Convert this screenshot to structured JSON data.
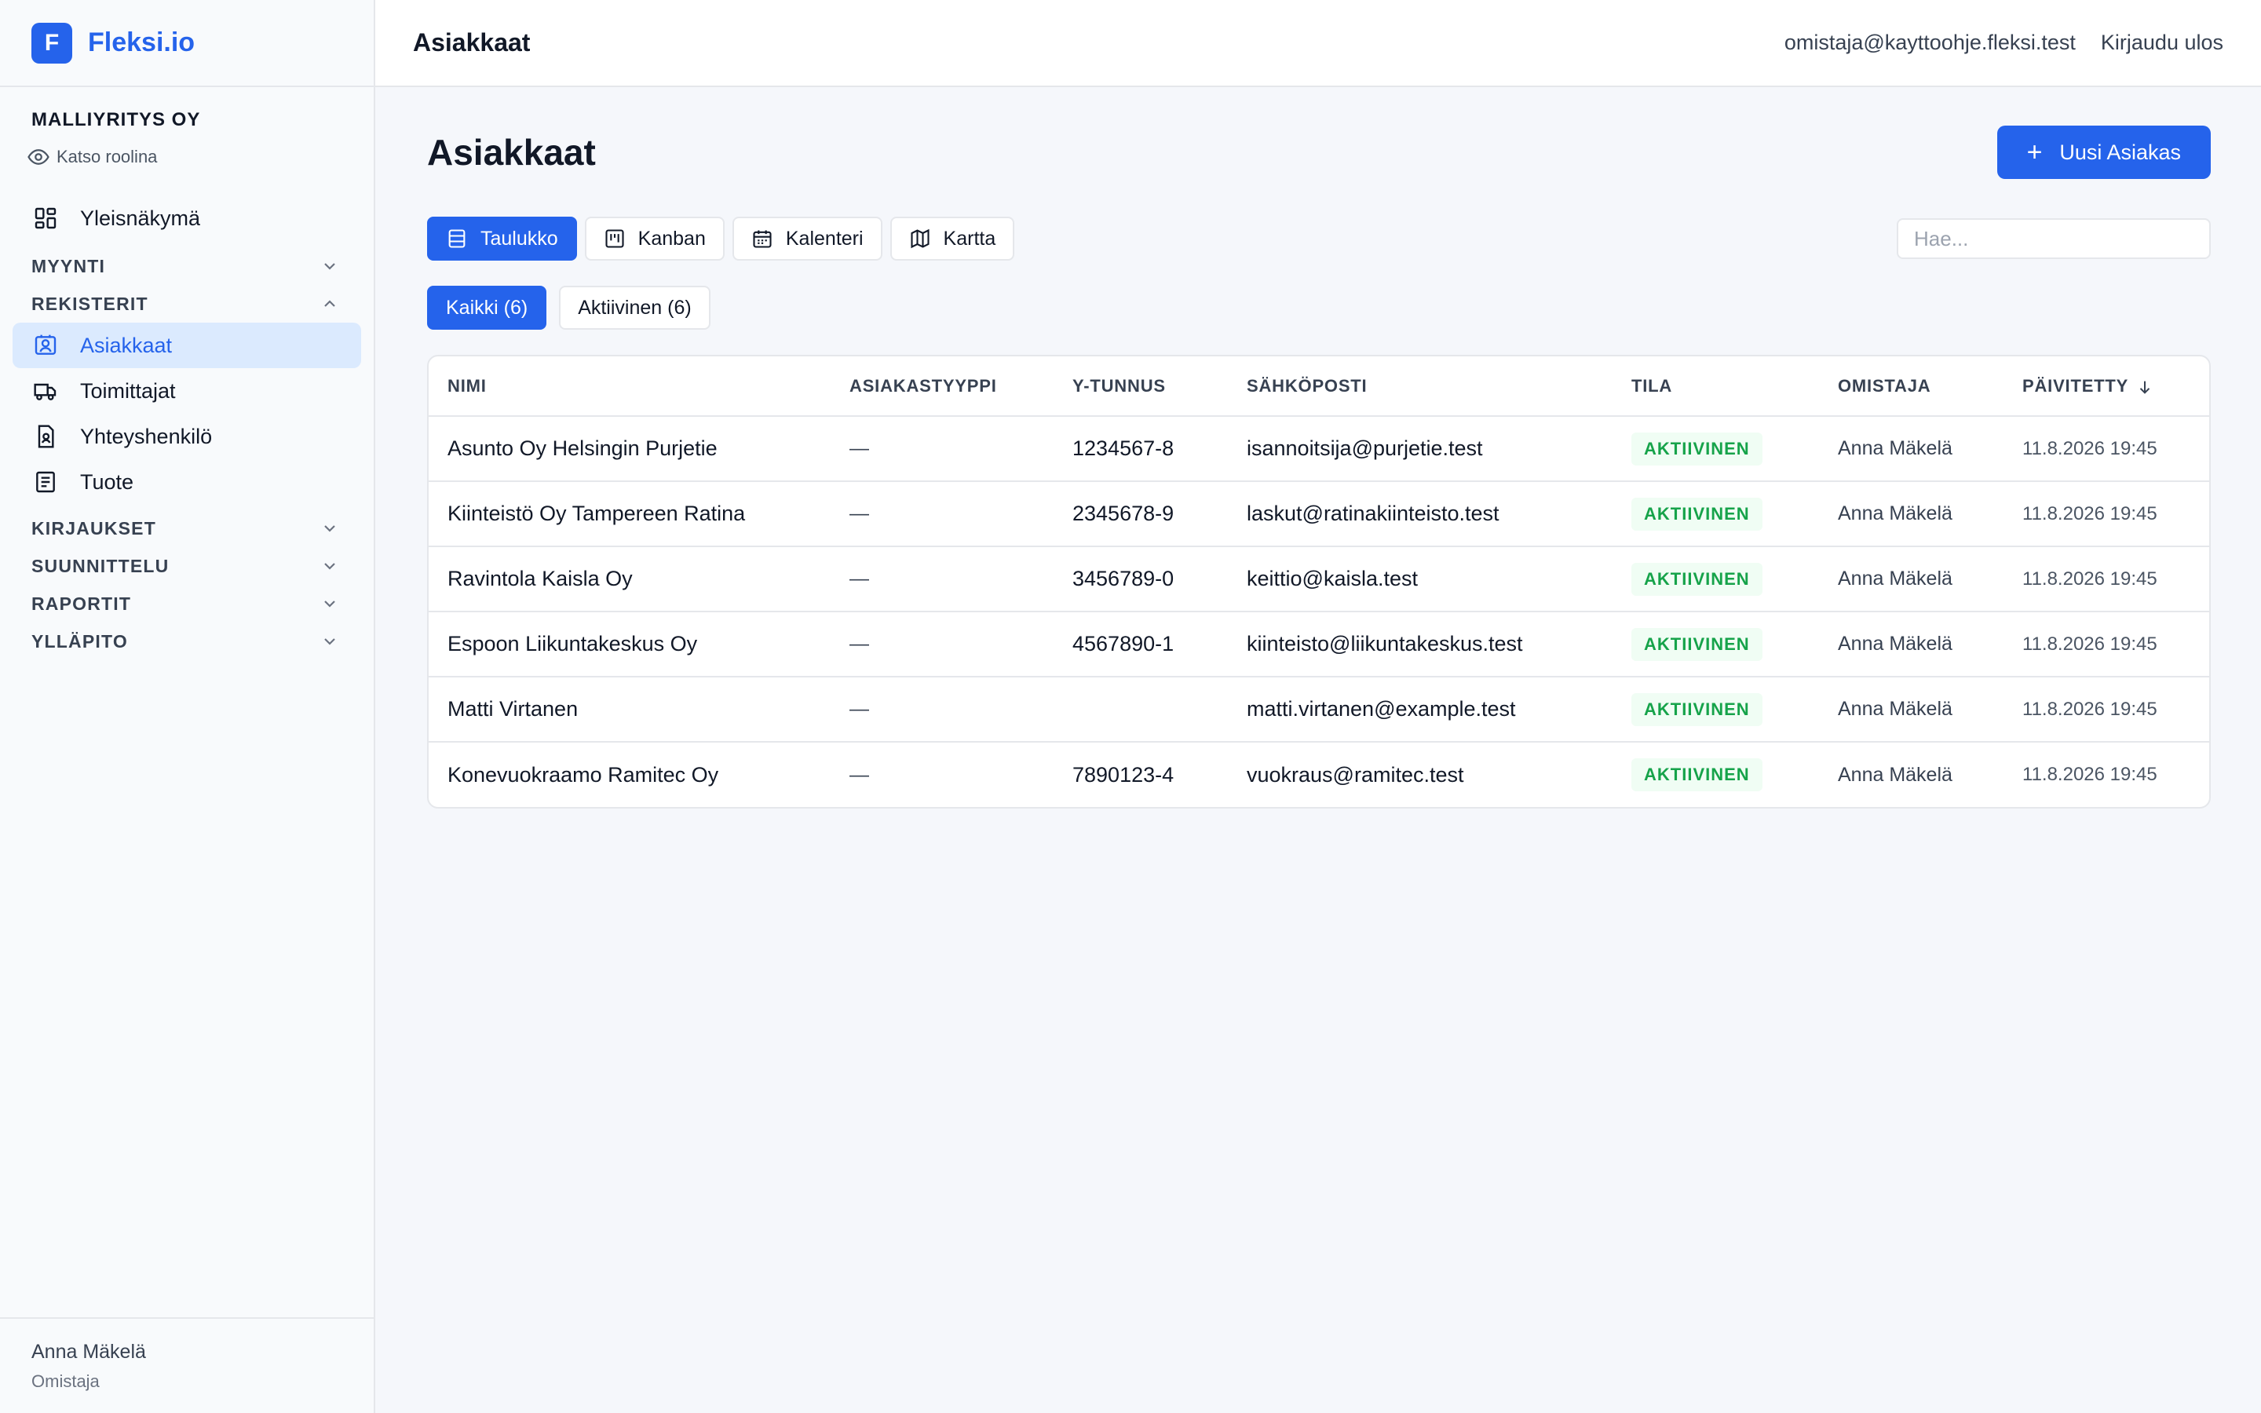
{
  "brand": {
    "logo_letter": "F",
    "name": "Fleksi.io"
  },
  "org": {
    "name": "MALLIYRITYS OY",
    "role_view_label": "Katso roolina"
  },
  "sidebar": {
    "overview_label": "Yleisnäkymä",
    "groups": {
      "myynti": "MYYNTI",
      "rekisterit": "REKISTERIT",
      "kirjaukset": "KIRJAUKSET",
      "suunnittelu": "SUUNNITTELU",
      "raportit": "RAPORTIT",
      "yllapito": "YLLÄPITO"
    },
    "registers": {
      "customers": "Asiakkaat",
      "suppliers": "Toimittajat",
      "contacts": "Yhteyshenkilö",
      "products": "Tuote"
    },
    "active_item": "Asiakkaat"
  },
  "user": {
    "name": "Anna Mäkelä",
    "role": "Omistaja"
  },
  "topbar": {
    "title": "Asiakkaat",
    "email": "omistaja@kayttoohje.fleksi.test",
    "logout_label": "Kirjaudu ulos"
  },
  "page": {
    "title": "Asiakkaat",
    "new_button_label": "Uusi Asiakas"
  },
  "views": {
    "table": "Taulukko",
    "kanban": "Kanban",
    "calendar": "Kalenteri",
    "map": "Kartta",
    "active": "Taulukko"
  },
  "search": {
    "placeholder": "Hae...",
    "value": ""
  },
  "filters": {
    "all": "Kaikki (6)",
    "active": "Aktiivinen (6)"
  },
  "table": {
    "headers": {
      "name": "NIMI",
      "type": "ASIAKASTYYPPI",
      "business_id": "Y-TUNNUS",
      "email": "SÄHKÖPOSTI",
      "status": "TILA",
      "owner": "OMISTAJA",
      "updated": "PÄIVITETTY"
    },
    "sort": {
      "column": "PÄIVITETTY",
      "direction": "desc"
    },
    "rows": [
      {
        "name": "Asunto Oy Helsingin Purjetie",
        "type": "—",
        "business_id": "1234567-8",
        "email": "isannoitsija@purjetie.test",
        "status": "AKTIIVINEN",
        "owner": "Anna Mäkelä",
        "updated": "11.8.2026 19:45"
      },
      {
        "name": "Kiinteistö Oy Tampereen Ratina",
        "type": "—",
        "business_id": "2345678-9",
        "email": "laskut@ratinakiinteisto.test",
        "status": "AKTIIVINEN",
        "owner": "Anna Mäkelä",
        "updated": "11.8.2026 19:45"
      },
      {
        "name": "Ravintola Kaisla Oy",
        "type": "—",
        "business_id": "3456789-0",
        "email": "keittio@kaisla.test",
        "status": "AKTIIVINEN",
        "owner": "Anna Mäkelä",
        "updated": "11.8.2026 19:45"
      },
      {
        "name": "Espoon Liikuntakeskus Oy",
        "type": "—",
        "business_id": "4567890-1",
        "email": "kiinteisto@liikuntakeskus.test",
        "status": "AKTIIVINEN",
        "owner": "Anna Mäkelä",
        "updated": "11.8.2026 19:45"
      },
      {
        "name": "Matti Virtanen",
        "type": "—",
        "business_id": "",
        "email": "matti.virtanen@example.test",
        "status": "AKTIIVINEN",
        "owner": "Anna Mäkelä",
        "updated": "11.8.2026 19:45"
      },
      {
        "name": "Konevuokraamo Ramitec Oy",
        "type": "—",
        "business_id": "7890123-4",
        "email": "vuokraus@ramitec.test",
        "status": "AKTIIVINEN",
        "owner": "Anna Mäkelä",
        "updated": "11.8.2026 19:45"
      }
    ]
  },
  "colors": {
    "accent": "#2563eb",
    "active_nav_bg": "#dbeafe",
    "status_text": "#16a34a",
    "status_bg": "#f0fdf4"
  }
}
